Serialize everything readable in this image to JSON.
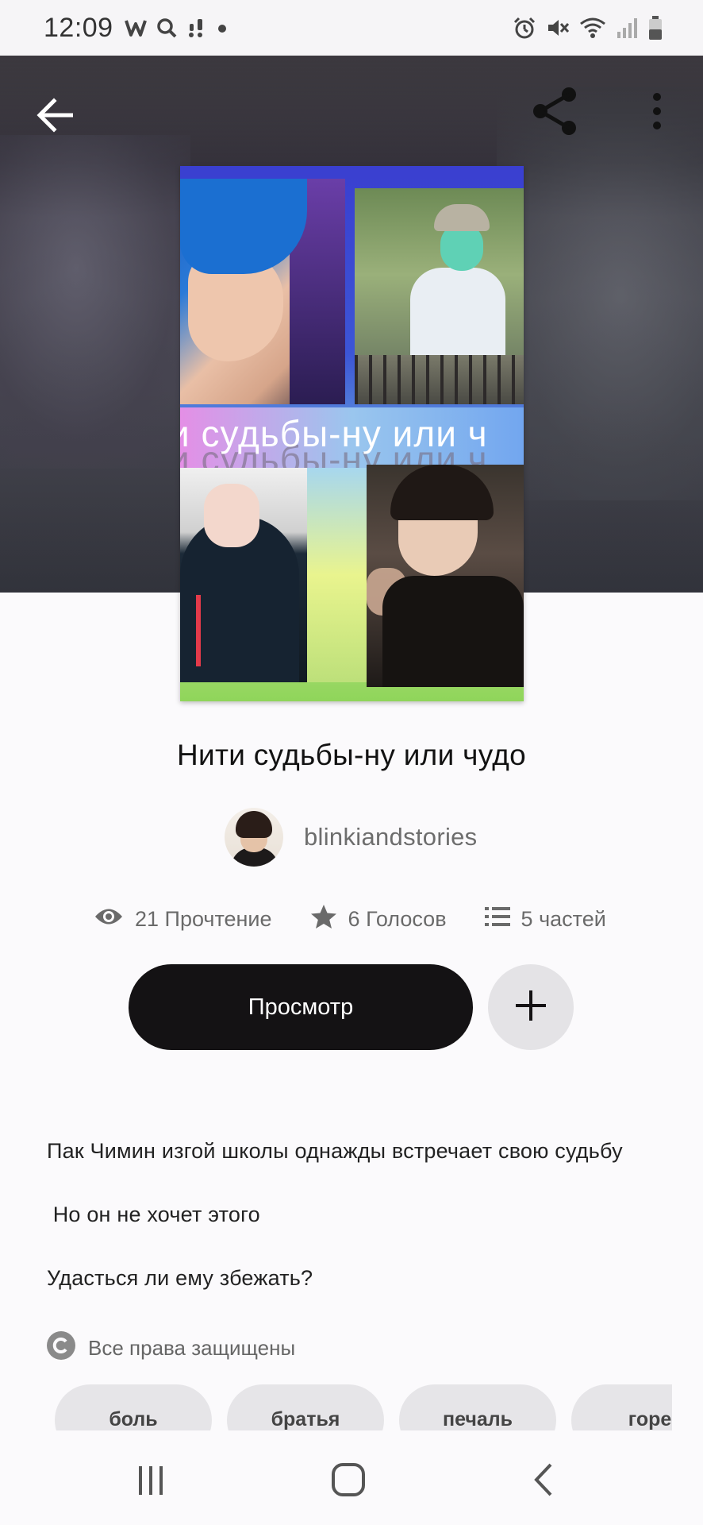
{
  "status_bar": {
    "time": "12:09",
    "left_icons": [
      "w-app-icon",
      "search-icon",
      "notification-icon",
      "dot-icon"
    ],
    "right_icons": [
      "alarm-icon",
      "mute-icon",
      "wifi-icon",
      "signal-icon",
      "battery-icon"
    ]
  },
  "header": {
    "back_icon": "arrow-left-icon",
    "share_icon": "share-icon",
    "more_icon": "more-vertical-icon"
  },
  "cover": {
    "band_text": "и судьбы-ну или ч"
  },
  "story": {
    "title": "Нити судьбы-ну или чудо",
    "author": "blinkiandstories"
  },
  "stats": {
    "reads": "21 Прочтение",
    "votes": "6 Голосов",
    "parts": "5 частей"
  },
  "actions": {
    "read_label": "Просмотр",
    "add_icon": "plus-icon"
  },
  "description": {
    "line1": "Пак Чимин изгой школы однажды встречает свою судьбу",
    "line2": " Но он не хочет этого",
    "line3": "Удасться ли ему збежать?"
  },
  "copyright": {
    "label": "Все права защищены"
  },
  "tags": [
    "боль",
    "братья",
    "печаль",
    "горе"
  ],
  "colors": {
    "primary_button": "#141214",
    "secondary_button": "#e4e3e6",
    "background": "#fbfafc",
    "tag_background": "#e6e5e8"
  },
  "navbar": {
    "icons": [
      "recent-apps-icon",
      "home-icon",
      "back-icon"
    ]
  }
}
